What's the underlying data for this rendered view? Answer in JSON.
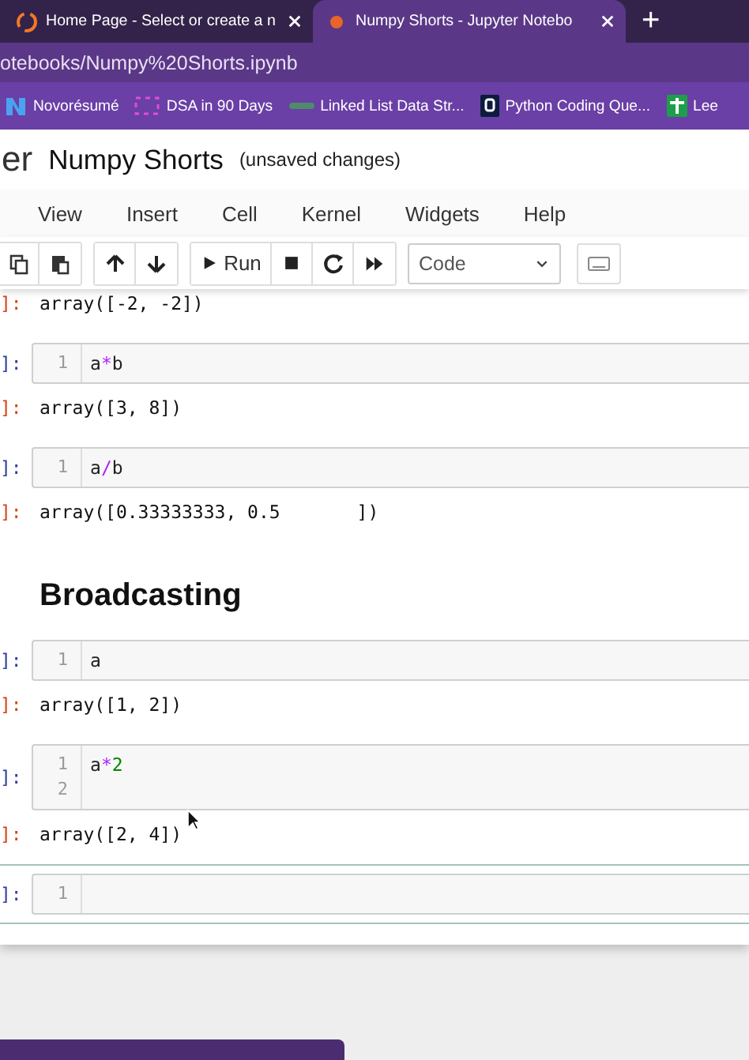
{
  "browser": {
    "tabs": [
      {
        "title": "Home Page - Select or create a n",
        "selected": false
      },
      {
        "title": "Numpy Shorts - Jupyter Notebo",
        "selected": true
      }
    ],
    "new_tab": "+",
    "address": "otebooks/Numpy%20Shorts.ipynb",
    "bookmarks": [
      {
        "label": "Novorésumé"
      },
      {
        "label": "DSA in 90 Days"
      },
      {
        "label": "Linked List Data Str..."
      },
      {
        "label": "Python Coding Que..."
      },
      {
        "label": "Lee"
      }
    ]
  },
  "notebook": {
    "logo_text": "er",
    "name": "Numpy Shorts",
    "status": "(unsaved changes)"
  },
  "menu": [
    "View",
    "Insert",
    "Cell",
    "Kernel",
    "Widgets",
    "Help"
  ],
  "toolbar": {
    "run_label": "Run",
    "cell_type": "Code"
  },
  "cells": [
    {
      "kind": "output",
      "prompt": "]:",
      "text": "array([-2, -2])"
    },
    {
      "kind": "code",
      "prompt": "]:",
      "selected": false,
      "lines": [
        {
          "number": "1",
          "tokens": [
            {
              "kind": "name",
              "text": "a"
            },
            {
              "kind": "operator",
              "text": "*"
            },
            {
              "kind": "name",
              "text": "b"
            }
          ]
        }
      ]
    },
    {
      "kind": "output",
      "prompt": "]:",
      "text": "array([3, 8])"
    },
    {
      "kind": "code",
      "prompt": "]:",
      "selected": false,
      "lines": [
        {
          "number": "1",
          "tokens": [
            {
              "kind": "name",
              "text": "a"
            },
            {
              "kind": "operator",
              "text": "/"
            },
            {
              "kind": "name",
              "text": "b"
            }
          ]
        }
      ]
    },
    {
      "kind": "output",
      "prompt": "]:",
      "text": "array([0.33333333, 0.5       ])"
    },
    {
      "kind": "heading",
      "text": "Broadcasting"
    },
    {
      "kind": "code",
      "prompt": "]:",
      "selected": false,
      "lines": [
        {
          "number": "1",
          "tokens": [
            {
              "kind": "name",
              "text": "a"
            }
          ]
        }
      ]
    },
    {
      "kind": "output",
      "prompt": "]:",
      "text": "array([1, 2])"
    },
    {
      "kind": "code",
      "prompt": "]:",
      "selected": false,
      "lines": [
        {
          "number": "1",
          "tokens": [
            {
              "kind": "name",
              "text": "a"
            },
            {
              "kind": "operator",
              "text": "*"
            },
            {
              "kind": "number",
              "text": "2"
            }
          ]
        },
        {
          "number": "2"
        }
      ]
    },
    {
      "kind": "output",
      "prompt": "]:",
      "text": "array([2, 4])"
    },
    {
      "kind": "code",
      "prompt": "]:",
      "selected": true,
      "lines": [
        {
          "number": "1"
        }
      ]
    }
  ]
}
